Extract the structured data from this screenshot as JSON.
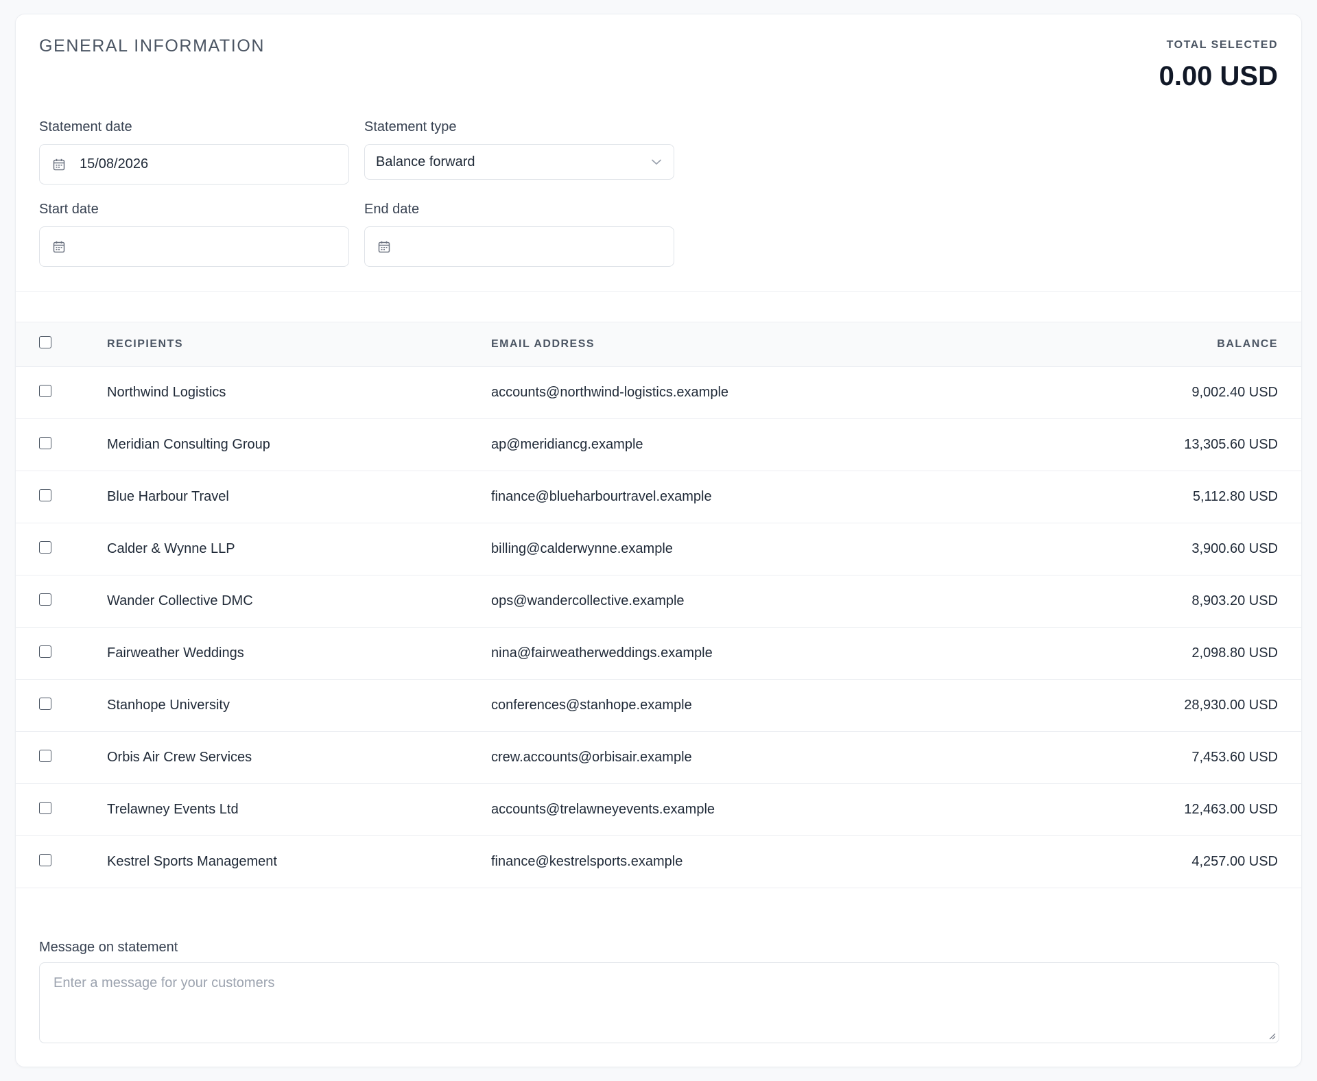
{
  "header": {
    "title": "GENERAL INFORMATION",
    "total_label": "TOTAL SELECTED",
    "total_value": "0.00 USD"
  },
  "form": {
    "statement_date": {
      "label": "Statement date",
      "value": "15/08/2026"
    },
    "statement_type": {
      "label": "Statement type",
      "value": "Balance forward"
    },
    "start_date": {
      "label": "Start date",
      "value": ""
    },
    "end_date": {
      "label": "End date",
      "value": ""
    }
  },
  "table": {
    "columns": {
      "recipients": "RECIPIENTS",
      "email": "EMAIL ADDRESS",
      "balance": "BALANCE"
    },
    "rows": [
      {
        "name": "Northwind Logistics",
        "email": "accounts@northwind-logistics.example",
        "balance": "9,002.40 USD"
      },
      {
        "name": "Meridian Consulting Group",
        "email": "ap@meridiancg.example",
        "balance": "13,305.60 USD"
      },
      {
        "name": "Blue Harbour Travel",
        "email": "finance@blueharbourtravel.example",
        "balance": "5,112.80 USD"
      },
      {
        "name": "Calder & Wynne LLP",
        "email": "billing@calderwynne.example",
        "balance": "3,900.60 USD"
      },
      {
        "name": "Wander Collective DMC",
        "email": "ops@wandercollective.example",
        "balance": "8,903.20 USD"
      },
      {
        "name": "Fairweather Weddings",
        "email": "nina@fairweatherweddings.example",
        "balance": "2,098.80 USD"
      },
      {
        "name": "Stanhope University",
        "email": "conferences@stanhope.example",
        "balance": "28,930.00 USD"
      },
      {
        "name": "Orbis Air Crew Services",
        "email": "crew.accounts@orbisair.example",
        "balance": "7,453.60 USD"
      },
      {
        "name": "Trelawney Events Ltd",
        "email": "accounts@trelawneyevents.example",
        "balance": "12,463.00 USD"
      },
      {
        "name": "Kestrel Sports Management",
        "email": "finance@kestrelsports.example",
        "balance": "4,257.00 USD"
      }
    ]
  },
  "message": {
    "label": "Message on statement",
    "placeholder": "Enter a message for your customers"
  },
  "icons": {
    "date_field": "calendar-icon",
    "select": "chevron-down-icon"
  }
}
